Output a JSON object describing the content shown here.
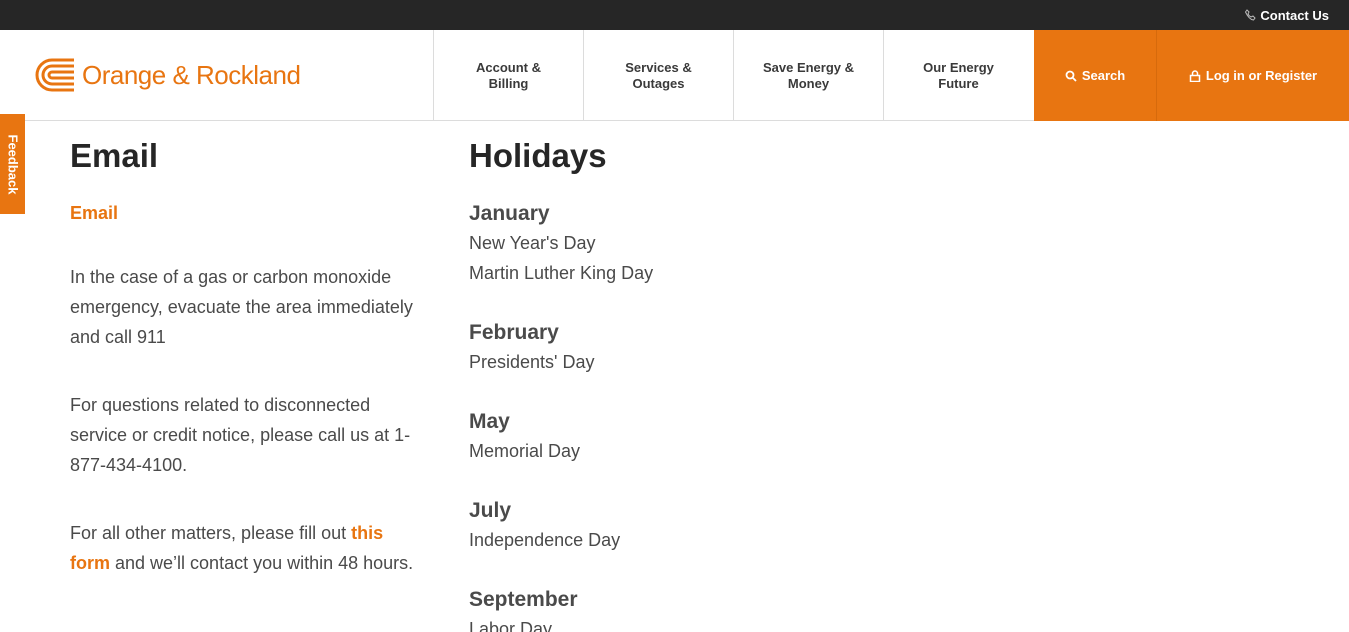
{
  "utility_bar": {
    "contact_label": "Contact Us"
  },
  "header": {
    "logo_text": "Orange & Rockland",
    "nav": [
      {
        "line1": "Account &",
        "line2": "Billing"
      },
      {
        "line1": "Services &",
        "line2": "Outages"
      },
      {
        "line1": "Save Energy &",
        "line2": "Money"
      },
      {
        "line1": "Our Energy",
        "line2": "Future"
      }
    ],
    "search_label": "Search",
    "login_label": "Log in or Register"
  },
  "feedback_label": "Feedback",
  "email_section": {
    "title": "Email",
    "email_link": "Email",
    "emergency_text": "In the case of a gas or carbon monoxide emergency, evacuate the area immediately and call 911",
    "disconnect_text": "For questions related to disconnected service or credit notice, please call us at 1-877-434-4100.",
    "other_prefix": "For all other matters, please fill out ",
    "other_link": "this form",
    "other_suffix": " and we’ll contact you within 48 hours."
  },
  "holidays_section": {
    "title": "Holidays",
    "months": [
      {
        "name": "January",
        "holidays": [
          "New Year's Day",
          "Martin Luther King Day"
        ]
      },
      {
        "name": "February",
        "holidays": [
          "Presidents' Day"
        ]
      },
      {
        "name": "May",
        "holidays": [
          "Memorial Day"
        ]
      },
      {
        "name": "July",
        "holidays": [
          "Independence Day"
        ]
      },
      {
        "name": "September",
        "holidays": [
          "Labor Day"
        ]
      }
    ]
  },
  "colors": {
    "brand": "#e87511",
    "topbar": "#262626",
    "text": "#4a4a4a",
    "heading": "#262626"
  }
}
